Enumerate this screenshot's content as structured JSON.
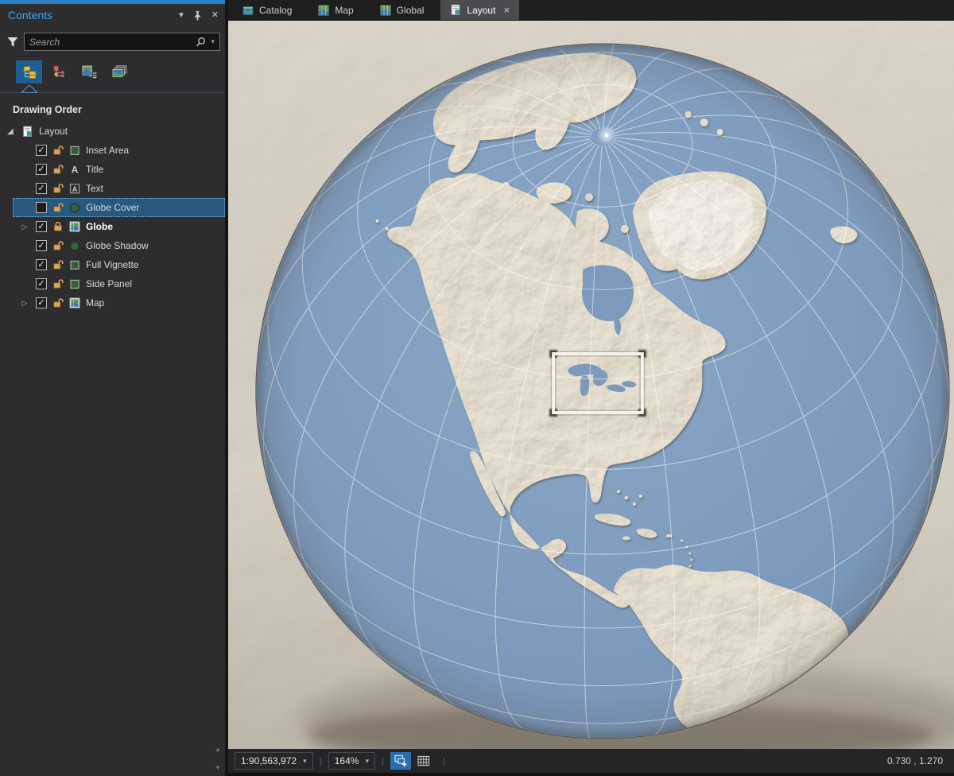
{
  "contents_panel": {
    "title": "Contents",
    "search_placeholder": "Search",
    "drawing_order_label": "Drawing Order",
    "toolbar": {
      "buttons": [
        "list-by-drawing-order",
        "list-by-element-type",
        "list-map-series-pages",
        "list-by-page"
      ],
      "active_button": "list-by-drawing-order"
    },
    "tree": {
      "root_label": "Layout",
      "rows": [
        {
          "label": "Inset Area",
          "icon": "green-rectangle-symbol",
          "checked": true,
          "lock": "unlocked"
        },
        {
          "label": "Title",
          "icon": "text-A-symbol",
          "checked": true,
          "lock": "unlocked"
        },
        {
          "label": "Text",
          "icon": "boxed-A-symbol",
          "checked": true,
          "lock": "unlocked"
        },
        {
          "label": "Globe Cover",
          "icon": "green-circle-symbol",
          "checked": false,
          "lock": "unlocked",
          "selected": true
        },
        {
          "label": "Globe",
          "icon": "map-frame",
          "checked": true,
          "lock": "locked",
          "bold": true,
          "expandable": true
        },
        {
          "label": "Globe Shadow",
          "icon": "green-circle-symbol",
          "checked": true,
          "lock": "unlocked"
        },
        {
          "label": "Full Vignette",
          "icon": "green-rectangle-symbol",
          "checked": true,
          "lock": "unlocked"
        },
        {
          "label": "Side Panel",
          "icon": "green-rectangle-symbol",
          "checked": true,
          "lock": "unlocked"
        },
        {
          "label": "Map",
          "icon": "map-frame",
          "checked": true,
          "lock": "unlocked",
          "expandable": true
        }
      ]
    }
  },
  "tabs": [
    {
      "label": "Catalog",
      "icon": "catalog-icon"
    },
    {
      "label": "Map",
      "icon": "map-icon"
    },
    {
      "label": "Global",
      "icon": "map-icon"
    },
    {
      "label": "Layout",
      "icon": "layout-icon",
      "active": true,
      "closable": true
    }
  ],
  "status_bar": {
    "scale": "1:90,563,972",
    "zoom": "164%",
    "coordinates": "0.730 , 1.270"
  },
  "ui_glyphs": {
    "chevron_down": "▾",
    "caret": "▾",
    "close": "✕",
    "tab_close": "×",
    "check": "✓",
    "expand_open": "◢",
    "expand_closed": "▷",
    "scroll_up": "▲",
    "scroll_down": "▼",
    "separator": "|"
  },
  "colors": {
    "accent_blue": "#2b7fc2",
    "selection_blue": "#27597f",
    "active_tool_blue": "#1f5e93",
    "ocean": "#7d9abc",
    "land": "#e8e0d0",
    "page_background": "#d9d2c6",
    "lock_orange": "#d9a45b"
  }
}
